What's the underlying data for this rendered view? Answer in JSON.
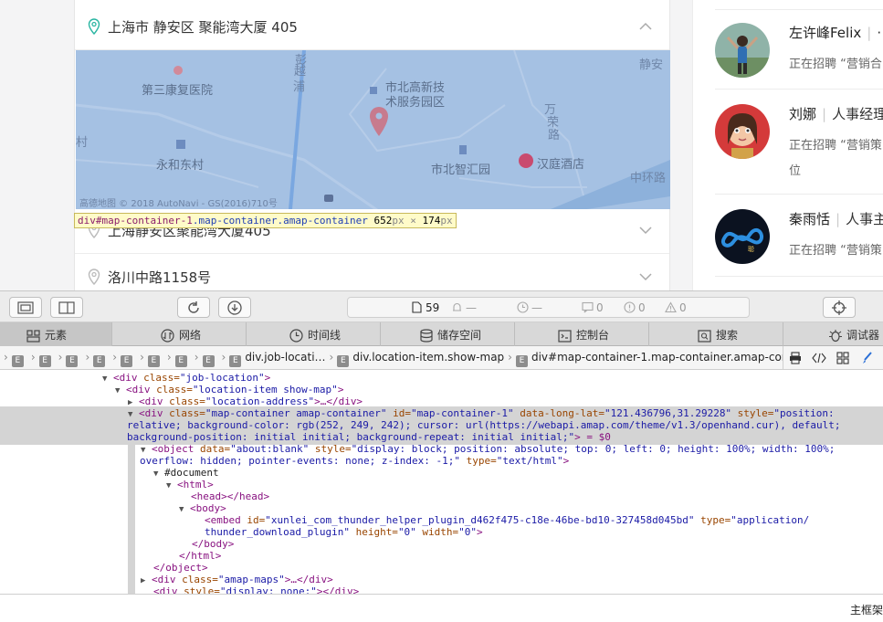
{
  "page": {
    "locations": [
      {
        "text": "上海市 静安区 聚能湾大厦 405"
      },
      {
        "text": "上海静安区聚能湾大厦405"
      },
      {
        "text": "洛川中路1158号"
      }
    ],
    "map": {
      "pois": [
        "第三康复医院",
        "市北高新技",
        "术服务园区",
        "永和东村",
        "市北智汇园",
        "汉庭酒店"
      ],
      "roads": [
        "彭",
        "越",
        "浦",
        "静安",
        "万",
        "荣",
        "路",
        "中环路",
        "村"
      ],
      "copyright": "高德地图 © 2018 AutoNavi - GS(2016)710号"
    },
    "inspector_tooltip": {
      "tag": "div#map-container-1",
      "classes": ".map-container.amap-container",
      "width": "652",
      "height": "174",
      "unit": "px",
      "times": "×"
    },
    "recruiters": [
      {
        "name": "左许峰Felix",
        "role": "·",
        "desc": "正在招聘 “营销合"
      },
      {
        "name": "刘娜",
        "role": "人事经理",
        "desc": "正在招聘 “营销策",
        "desc2": "位"
      },
      {
        "name": "秦雨恬",
        "role": "人事主",
        "desc": "正在招聘 “营销策"
      }
    ]
  },
  "devtools": {
    "resource_count": "59",
    "counters": [
      "—",
      "—",
      "0",
      "0",
      "0"
    ],
    "tabs": [
      {
        "label": "元素",
        "icon": "elements-icon"
      },
      {
        "label": "网络",
        "icon": "network-icon"
      },
      {
        "label": "时间线",
        "icon": "timeline-icon"
      },
      {
        "label": "储存空间",
        "icon": "storage-icon"
      },
      {
        "label": "控制台",
        "icon": "console-icon"
      },
      {
        "label": "搜索",
        "icon": "search-icon"
      },
      {
        "label": "调试器",
        "icon": "debugger-icon"
      }
    ],
    "breadcrumb": {
      "e": "E",
      "items": [
        "div.job-locati…",
        "div.location-item.show-map",
        "div#map-container-1.map-container.amap-container"
      ]
    },
    "dom": {
      "l1_tag": "<div",
      "l1_an": " class=",
      "l1_av": "\"job-location\"",
      "l1_end": ">",
      "l2_tag": "<div",
      "l2_an": " class=",
      "l2_av": "\"location-item show-map\"",
      "l2_end": ">",
      "l3_tag": "<div",
      "l3_an": " class=",
      "l3_av": "\"location-address\"",
      "l3_end": ">…</div>",
      "l4_tag": "<div",
      "l4_an1": " class=",
      "l4_av1": "\"map-container amap-container\"",
      "l4_an2": " id=",
      "l4_av2": "\"map-container-1\"",
      "l4_an3": " data-long-lat=",
      "l4_av3": "\"121.436796,31.29228\"",
      "l4_an4": " style=",
      "l4_av4": "\"position:",
      "l5": "relative; background-color: rgb(252, 249, 242); cursor: url(https://webapi.amap.com/theme/v1.3/openhand.cur), default;",
      "l6": "background-position: initial initial; background-repeat: initial initial;\"",
      "l6_end": "> = $0",
      "l7_tag": "<object",
      "l7_an1": " data=",
      "l7_av1": "\"about:blank\"",
      "l7_an2": " style=",
      "l7_av2": "\"display: block; position: absolute; top: 0; left: 0; height: 100%; width: 100%;",
      "l8": "overflow: hidden; pointer-events: none; z-index: -1;\"",
      "l8_an": " type=",
      "l8_av": "\"text/html\"",
      "l8_end": ">",
      "l9": "#document",
      "l10": "<html>",
      "l11": "<head></head>",
      "l12": "<body>",
      "l13_tag": "<embed",
      "l13_an1": " id=",
      "l13_av1": "\"xunlei_com_thunder_helper_plugin_d462f475-c18e-46be-bd10-327458d045bd\"",
      "l13_an2": " type=",
      "l13_av2": "\"application/",
      "l14_av": "thunder_download_plugin\"",
      "l14_an1": " height=",
      "l14_av1": "\"0\"",
      "l14_an2": " width=",
      "l14_av2": "\"0\"",
      "l14_end": ">",
      "l15": "</body>",
      "l16": "</html>",
      "l17": "</object>",
      "l18_tag": "<div",
      "l18_an": " class=",
      "l18_av": "\"amap-maps\"",
      "l18_end": ">…</div>",
      "l19_tag": "<div",
      "l19_an": " style=",
      "l19_av": "\"display: none;\"",
      "l19_end": "></div>"
    },
    "console_right": "主框架"
  }
}
